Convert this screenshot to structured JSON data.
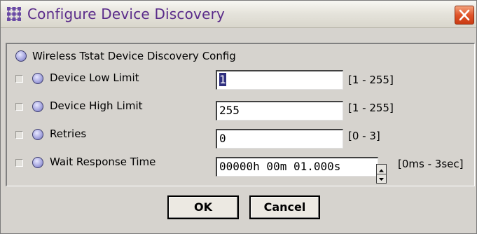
{
  "window": {
    "title": "Configure Device Discovery",
    "icon": "grid-network-icon",
    "close_icon": "close-x-icon"
  },
  "panel": {
    "header_label": "Wireless Tstat Device Discovery Config",
    "rows": [
      {
        "label": "Device Low Limit",
        "value_selected": "1",
        "value_rest": "",
        "range": "[1 - 255]"
      },
      {
        "label": "Device High Limit",
        "value_selected": "",
        "value_rest": "255",
        "range": "[1 - 255]"
      },
      {
        "label": "Retries",
        "value_selected": "",
        "value_rest": "0",
        "range": "[0 - 3]"
      },
      {
        "label": "Wait Response Time",
        "value_selected": "",
        "value_rest": "00000h 00m 01.000s",
        "range": "[0ms - 3sec]"
      }
    ]
  },
  "buttons": {
    "ok": "OK",
    "cancel": "Cancel"
  },
  "colors": {
    "title_text": "#5a2b8a",
    "close_button": "#e0542a",
    "background": "#d6d3ce",
    "radio": "#a9a9e0",
    "selection": "#2f2f7f"
  }
}
